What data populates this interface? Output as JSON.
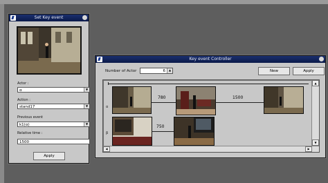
{
  "set_key_window": {
    "title": "Set Key event",
    "actor_label": "Actor :",
    "actor_value": "α",
    "action_label": "Action :",
    "action_value": "stand17",
    "previous_label": "Previous event",
    "previous_value": "k1(α)",
    "relative_label": "Relative time :",
    "relative_value": "1500",
    "apply_label": "Apply"
  },
  "controller_window": {
    "title": "Key event Controller",
    "number_of_actor_label": "Number of Actor",
    "number_of_actor_value": "6",
    "new_label": "New",
    "apply_label": "Apply",
    "rows": [
      {
        "label": "α",
        "times": [
          "780",
          "1500"
        ]
      },
      {
        "label": "β",
        "times": [
          "750"
        ]
      }
    ]
  }
}
